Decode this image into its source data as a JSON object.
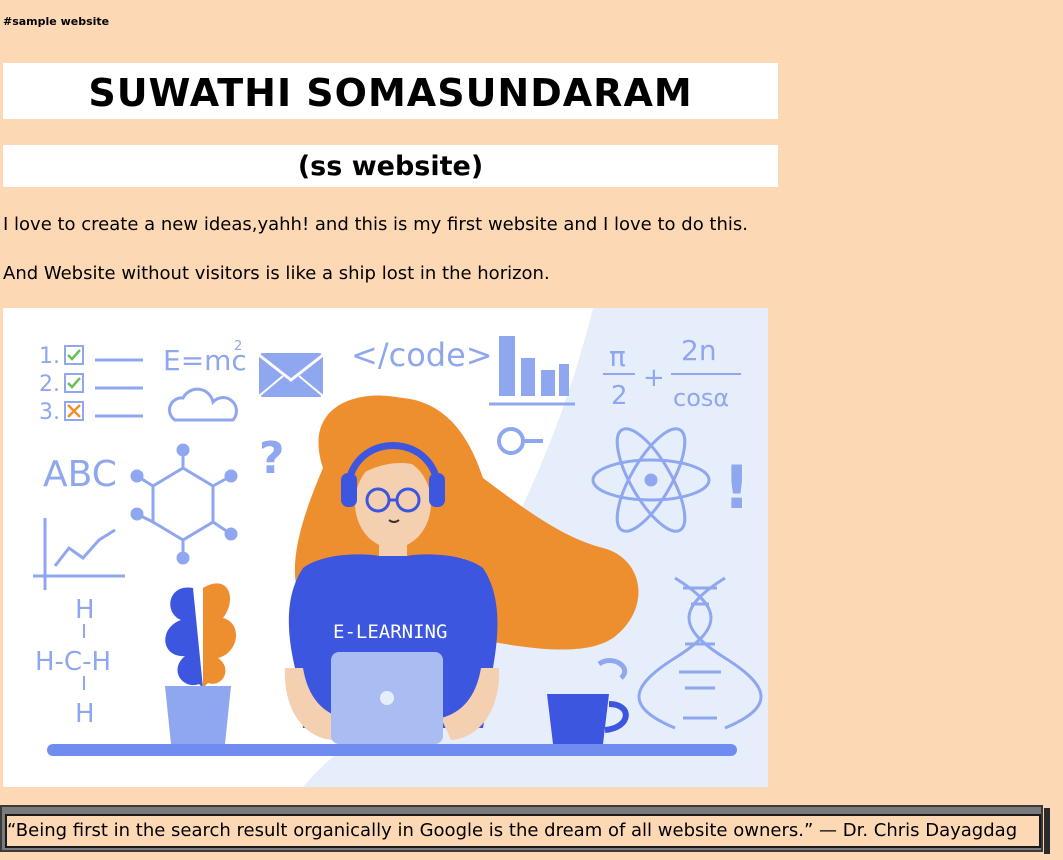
{
  "page": {
    "tag": "#sample website",
    "title": "SUWATHI SOMASUNDARAM",
    "subtitle": "(ss website)",
    "paragraphs": [
      "I love to create a new ideas,yahh! and this is my first website and I love to do this.",
      "And Website without visitors is like a ship lost in the horizon."
    ],
    "quote": "“Being first in the search result organically in Google is the dream of all website owners.” — Dr. Chris Dayagdag"
  },
  "illustration": {
    "shirt_text": "E-LEARNING",
    "code_text": "</code>",
    "formula_text": "E=mc",
    "formula_exp": "2",
    "abc_text": "ABC",
    "checklist": [
      "1.",
      "2.",
      "3."
    ],
    "pi_top": "π",
    "pi_bottom": "2",
    "plus": "+",
    "frac_top": "2n",
    "frac_bottom": "cosα",
    "question": "?",
    "exclaim": "!",
    "chem": [
      "H",
      "H-C-H",
      "H"
    ]
  },
  "colors": {
    "background": "#fdd8b5",
    "banner": "#ffffff",
    "hair": "#ee8f2f",
    "shirt": "#3c56e0",
    "accent_blue": "#8ea7ee",
    "light_blue": "#e6eefb"
  }
}
